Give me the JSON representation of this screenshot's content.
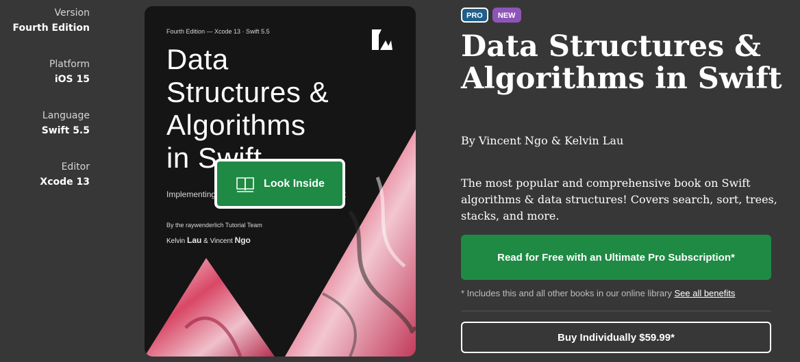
{
  "meta": [
    {
      "label": "Version",
      "value": "Fourth Edition"
    },
    {
      "label": "Platform",
      "value": "iOS 15"
    },
    {
      "label": "Language",
      "value": "Swift 5.5"
    },
    {
      "label": "Editor",
      "value": "Xcode 13"
    }
  ],
  "cover": {
    "edition": "Fourth Edition — Xcode 13 · Swift 5.5",
    "title_lines": [
      "Data",
      "Structures &",
      "Algorithms",
      "in Swift"
    ],
    "subtitle": "Implementing Practical Data Structures with Swift",
    "team": "By the raywenderlich Tutorial Team",
    "authors_prefix": "Kelvin",
    "author1_last": "Lau",
    "authors_mid": "& Vincent",
    "author2_last": "Ngo",
    "look_inside_label": "Look Inside",
    "logo_icon": "raywenderlich-logo-icon",
    "book_icon": "open-book-icon"
  },
  "badges": {
    "pro": "PRO",
    "new": "NEW"
  },
  "colors": {
    "background": "#373737",
    "accent_green": "#1e8a44",
    "pro_badge": "#1f5f8a",
    "new_badge": "#8e55b8"
  },
  "book": {
    "title": "Data Structures & Algorithms in Swift",
    "authors": "By Vincent Ngo & Kelvin Lau",
    "description": "The most popular and comprehensive book on Swift algorithms & data structures! Covers search, sort, trees, stacks, and more."
  },
  "actions": {
    "read_free": "Read for Free with an Ultimate Pro Subscription*",
    "footnote": "* Includes this and all other books in our online library",
    "see_benefits": "See all benefits",
    "buy": "Buy Individually $59.99*"
  }
}
